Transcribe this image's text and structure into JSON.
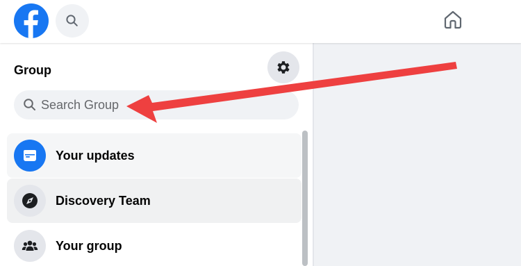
{
  "header": {
    "logo_icon": "facebook-logo-icon",
    "search_icon": "search-icon",
    "home_icon": "home-icon",
    "brand_color": "#1877f2"
  },
  "sidebar": {
    "title": "Group",
    "settings_icon": "gear-icon",
    "search": {
      "placeholder": "Search Group"
    },
    "items": [
      {
        "label": "Your updates",
        "icon": "updates-icon"
      },
      {
        "label": "Discovery Team",
        "icon": "discovery-icon"
      },
      {
        "label": "Your group",
        "icon": "people-group-icon"
      }
    ]
  },
  "annotation": {
    "arrow_color": "#ee4040"
  }
}
